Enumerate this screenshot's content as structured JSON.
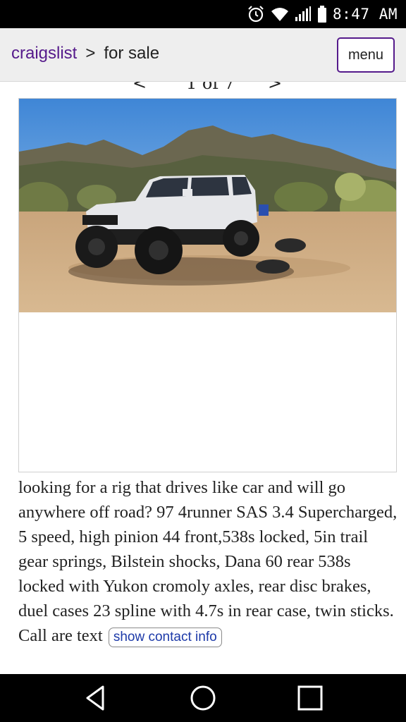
{
  "status_bar": {
    "time": "8:47 AM"
  },
  "header": {
    "home": "craigslist",
    "separator": ">",
    "section": "for sale",
    "menu_label": "menu"
  },
  "gallery": {
    "prev_arrow": "<",
    "counter": "1 of 7",
    "next_arrow": ">"
  },
  "posting": {
    "body": "looking for a rig that drives like car and will go anywhere off road? 97 4runner SAS 3.4 Supercharged, 5 speed, high pinion 44 front,538s locked, 5in trail gear springs, Bilstein shocks, Dana 60 rear 538s locked with Yukon cromoly axles, rear disc brakes, duel cases 23 spline with 4.7s in rear case, twin sticks. Call are text",
    "contact_label": "show contact info"
  },
  "colors": {
    "link": "#551a8b",
    "contact": "#1c39a8",
    "header_bg": "#eeeeee"
  }
}
